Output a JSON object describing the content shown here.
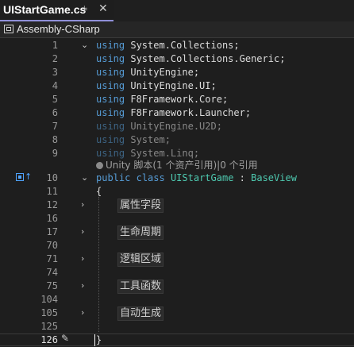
{
  "tab": {
    "title": "UIStartGame.cs",
    "pin": "⊧",
    "close": "✕"
  },
  "navbar": {
    "label": "Assembly-CSharp",
    "icon": "assembly-icon"
  },
  "usings": [
    {
      "ln": "1",
      "ns": "System.Collections",
      "used": true
    },
    {
      "ln": "2",
      "ns": "System.Collections.Generic",
      "used": true
    },
    {
      "ln": "3",
      "ns": "UnityEngine",
      "used": true
    },
    {
      "ln": "4",
      "ns": "UnityEngine.UI",
      "used": true
    },
    {
      "ln": "5",
      "ns": "F8Framework.Core",
      "used": true
    },
    {
      "ln": "6",
      "ns": "F8Framework.Launcher",
      "used": true
    },
    {
      "ln": "7",
      "ns": "UnityEngine.U2D",
      "used": false
    },
    {
      "ln": "8",
      "ns": "System",
      "used": false
    },
    {
      "ln": "9",
      "ns": "System.Linq",
      "used": false
    }
  ],
  "codelens": "Unity 脚本(1 个资产引用)|0 个引用",
  "class_line": {
    "ln": "10",
    "kw1": "public",
    "kw2": "class",
    "name": "UIStartGame",
    "sep": " : ",
    "base": "BaseView"
  },
  "brace_open": {
    "ln": "11",
    "text": "{"
  },
  "regions": [
    {
      "ln": "12",
      "label": "属性字段"
    },
    {
      "ln": "16",
      "label": ""
    },
    {
      "ln": "17",
      "label": "生命周期"
    },
    {
      "ln": "70",
      "label": ""
    },
    {
      "ln": "71",
      "label": "逻辑区域"
    },
    {
      "ln": "74",
      "label": ""
    },
    {
      "ln": "75",
      "label": "工具函数"
    },
    {
      "ln": "104",
      "label": ""
    },
    {
      "ln": "105",
      "label": "自动生成"
    },
    {
      "ln": "125",
      "label": ""
    }
  ],
  "brace_close": {
    "ln": "126",
    "text": "}"
  },
  "keyword_using": "using"
}
